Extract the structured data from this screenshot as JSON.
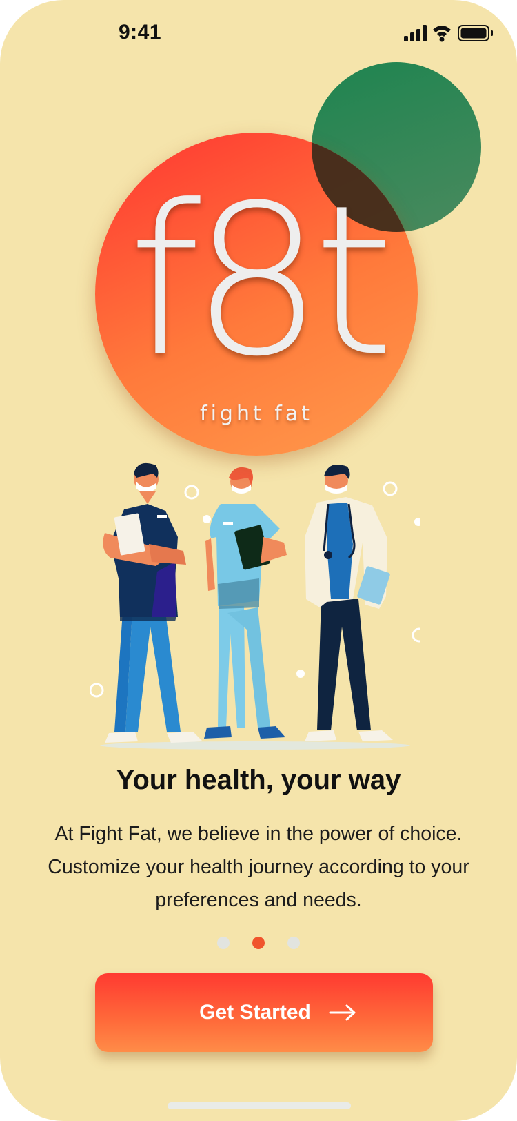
{
  "status_bar": {
    "time": "9:41",
    "icons": [
      "signal-icon",
      "wifi-icon",
      "battery-icon"
    ]
  },
  "logo": {
    "word": "f8t",
    "tagline": "fight fat"
  },
  "illustration": {
    "name": "three-medical-staff-illustration"
  },
  "content": {
    "headline": "Your health, your way",
    "description_lines": [
      "At Fight Fat, we believe in the power of choice.",
      "Customize your health journey according to your",
      "preferences and needs."
    ]
  },
  "pager": {
    "total": 3,
    "active_index": 1
  },
  "cta": {
    "label": "Get Started",
    "icon": "arrow-right-icon"
  },
  "colors": {
    "background": "#f5e4ab",
    "primary_red": "#ff3531",
    "primary_orange": "#ff9a4c",
    "accent_green": "#1e8450",
    "active_dot": "#f0542c"
  }
}
